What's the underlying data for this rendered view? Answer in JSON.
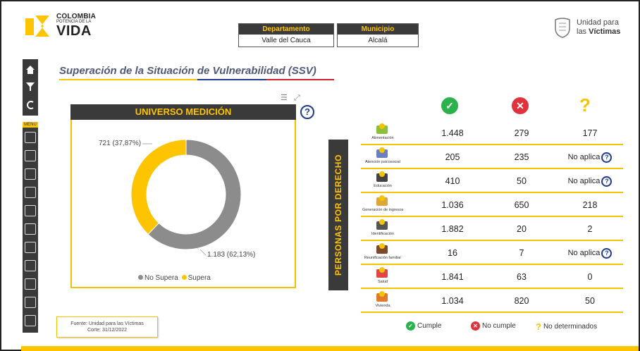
{
  "header": {
    "logo_left": {
      "line1": "COLOMBIA",
      "line2": "POTENCIA DE LA",
      "line3": "VIDA"
    },
    "filters": [
      {
        "label": "Departamento",
        "value": "Valle del Cauca"
      },
      {
        "label": "Municipio",
        "value": "Alcalá"
      }
    ],
    "logo_right": {
      "line1": "Unidad para",
      "line2_prefix": "las ",
      "line2_bold": "Víctimas"
    }
  },
  "sidebar": {
    "top_icons": [
      "home-icon",
      "filter-icon",
      "refresh-icon"
    ],
    "menu_label": "MENU",
    "nav_icons": [
      "hand-icon",
      "people-icon",
      "document-icon",
      "group-chart-icon",
      "bar-chart-icon",
      "map-icon",
      "list-icon",
      "people-bar-icon",
      "person-money-icon",
      "building-icon",
      "report-icon"
    ]
  },
  "page": {
    "title": "Superación de la Situación de Vulnerabilidad (SSV)"
  },
  "universe_card": {
    "header": "UNIVERSO MEDICIÓN",
    "help_label": "?",
    "tool_icons": [
      "filter-lines-icon",
      "expand-icon"
    ],
    "label_supera": "721 (37,87%)",
    "label_no_supera": "1.183 (62,13%)",
    "legend": [
      {
        "label": "No Supera",
        "color": "#8c8c8c"
      },
      {
        "label": "Supera",
        "color": "#ffc400"
      }
    ]
  },
  "chart_data": {
    "type": "pie",
    "categories": [
      "No Supera",
      "Supera"
    ],
    "values": [
      1183,
      721
    ],
    "percentages": [
      62.13,
      37.87
    ],
    "donut": true,
    "colors": [
      "#8c8c8c",
      "#ffc400"
    ],
    "title": "UNIVERSO MEDICIÓN",
    "legend_position": "bottom"
  },
  "rights_table": {
    "banner": "PERSONAS POR DERECHO",
    "columns": [
      {
        "icon": "check-icon",
        "meaning": "Cumple"
      },
      {
        "icon": "x-icon",
        "meaning": "No cumple"
      },
      {
        "icon": "question-icon",
        "meaning": "No determinados"
      }
    ],
    "rows": [
      {
        "label": "Alimentación",
        "icon": "food-icon",
        "cumple": "1.448",
        "no_cumple": "279",
        "no_det": "177"
      },
      {
        "label": "Atención psicosocial",
        "icon": "psychosocial-icon",
        "cumple": "205",
        "no_cumple": "235",
        "no_det": "No aplica"
      },
      {
        "label": "Educación",
        "icon": "education-icon",
        "cumple": "410",
        "no_cumple": "50",
        "no_det": "No aplica"
      },
      {
        "label": "Generación de ingresos",
        "icon": "income-icon",
        "cumple": "1.036",
        "no_cumple": "650",
        "no_det": "218"
      },
      {
        "label": "Identificación",
        "icon": "id-card-icon",
        "cumple": "1.882",
        "no_cumple": "20",
        "no_det": "2"
      },
      {
        "label": "Reunificación familiar",
        "icon": "family-icon",
        "cumple": "16",
        "no_cumple": "7",
        "no_det": "No aplica"
      },
      {
        "label": "Salud",
        "icon": "health-icon",
        "cumple": "1.841",
        "no_cumple": "63",
        "no_det": "0"
      },
      {
        "label": "Vivienda",
        "icon": "house-icon",
        "cumple": "1.034",
        "no_cumple": "820",
        "no_det": "50"
      }
    ]
  },
  "bottom_legend": {
    "cumple": "Cumple",
    "no_cumple": "No cumple",
    "no_det": "No determinados"
  },
  "source": {
    "line1": "Fuente: Unidad para las Víctimas",
    "line2": "Corte: 31/12/2022"
  },
  "colors": {
    "accent_yellow": "#ffc400",
    "dark": "#3a3a3a",
    "green": "#2bb24c",
    "red": "#e0323c",
    "navy": "#1e3a8a"
  }
}
